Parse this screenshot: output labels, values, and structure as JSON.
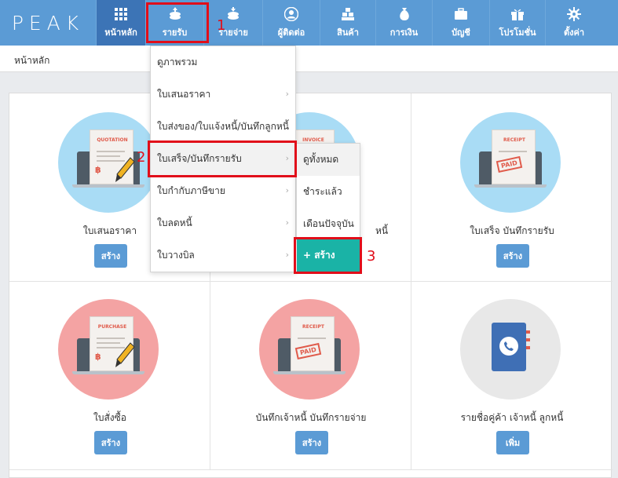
{
  "logo": "PEAK",
  "nav": [
    {
      "label": "หน้าหลัก",
      "icon": "grid-icon"
    },
    {
      "label": "รายรับ",
      "icon": "coins-icon"
    },
    {
      "label": "รายจ่าย",
      "icon": "coins-out-icon"
    },
    {
      "label": "ผู้ติดต่อ",
      "icon": "person-icon"
    },
    {
      "label": "สินค้า",
      "icon": "boxes-icon"
    },
    {
      "label": "การเงิน",
      "icon": "money-bag-icon"
    },
    {
      "label": "บัญชี",
      "icon": "briefcase-icon"
    },
    {
      "label": "โปรโมชั่น",
      "icon": "gift-icon"
    },
    {
      "label": "ตั้งค่า",
      "icon": "gear-icon"
    }
  ],
  "breadcrumb": "หน้าหลัก",
  "revenue_menu": [
    {
      "label": "ดูภาพรวม",
      "submenu": false
    },
    {
      "label": "ใบเสนอราคา",
      "submenu": true
    },
    {
      "label": "ใบส่งของ/ใบแจ้งหนี้/บันทึกลูกหนี้",
      "submenu": true
    },
    {
      "label": "ใบเสร็จ/บันทึกรายรับ",
      "submenu": true
    },
    {
      "label": "ใบกำกับภาษีขาย",
      "submenu": true
    },
    {
      "label": "ใบลดหนี้",
      "submenu": true
    },
    {
      "label": "ใบวางบิล",
      "submenu": true
    }
  ],
  "receipt_submenu": [
    {
      "label": "ดูทั้งหมด"
    },
    {
      "label": "ชำระแล้ว"
    },
    {
      "label": "เดือนปัจจุบัน"
    }
  ],
  "create_button": "+ สร้าง",
  "annotations": [
    "1",
    "2",
    "3"
  ],
  "cards": [
    {
      "label": "ใบเสนอราคา",
      "button": "สร้าง",
      "doc": "QUOTATION",
      "bg": "#a9dcf5",
      "icon": "quotation-laptop-icon"
    },
    {
      "label": "หนี้",
      "button": "",
      "doc": "INVOICE",
      "bg": "#a9dcf5",
      "icon": "invoice-laptop-icon"
    },
    {
      "label": "ใบเสร็จ บันทึกรายรับ",
      "button": "สร้าง",
      "doc": "RECEIPT",
      "stamp": "PAID",
      "bg": "#a9dcf5",
      "icon": "receipt-laptop-icon"
    },
    {
      "label": "ใบสั่งซื้อ",
      "button": "สร้าง",
      "doc": "PURCHASE",
      "bg": "#f4a3a3",
      "icon": "purchase-laptop-icon"
    },
    {
      "label": "บันทึกเจ้าหนี้ บันทึกรายจ่าย",
      "button": "สร้าง",
      "doc": "RECEIPT",
      "stamp": "PAID",
      "bg": "#f4a3a3",
      "icon": "expense-laptop-icon"
    },
    {
      "label": "รายชื่อคู่ค้า เจ้าหนี้ ลูกหนี้",
      "button": "เพิ่ม",
      "bg": "#e8e8e8",
      "icon": "contact-book-icon"
    }
  ],
  "colors": {
    "nav": "#5b9bd5",
    "nav_active": "#3c74b6",
    "accent_teal": "#1ab3a6",
    "annotation_red": "#e10e1a"
  }
}
